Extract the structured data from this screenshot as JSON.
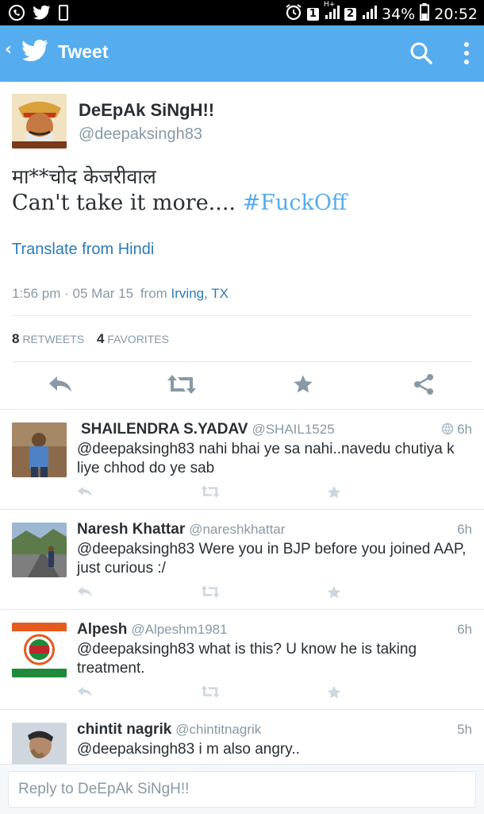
{
  "status_bar": {
    "battery_percent": "34%",
    "time": "20:52",
    "sim1": "1",
    "sim2": "2",
    "network_label": "H+"
  },
  "app_bar": {
    "title": "Tweet"
  },
  "tweet": {
    "author_name": "DeEpAk SiNgH!!",
    "author_handle": "@deepaksingh83",
    "text_line1": "मा**चोद केजरीवाल",
    "text_line2_prefix": "Can't take it more.... ",
    "hashtag": "#FuckOff",
    "translate_label": "Translate from Hindi",
    "timestamp": "1:56 pm · 05 Mar 15",
    "from_label": "from",
    "location": "Irving, TX",
    "retweets_count": "8",
    "retweets_label": "RETWEETS",
    "favorites_count": "4",
    "favorites_label": "FAVORITES"
  },
  "replies": [
    {
      "name": "SHAILENDRA S.YADAV",
      "handle": "@SHAIL1525",
      "time": "6h",
      "text": "@deepaksingh83 nahi bhai ye sa nahi..navedu chutiya k liye chhod do ye sab"
    },
    {
      "name": "Naresh Khattar",
      "handle": "@nareshkhattar",
      "time": "6h",
      "text": "@deepaksingh83 Were you in BJP before you joined AAP, just curious :/"
    },
    {
      "name": "Alpesh",
      "handle": "@Alpeshm1981",
      "time": "6h",
      "text": "@deepaksingh83 what is this? U know he is taking treatment."
    },
    {
      "name": "chintit nagrik",
      "handle": "@chintitnagrik",
      "time": "5h",
      "text": "@deepaksingh83 i m also angry.."
    }
  ],
  "reply_box": {
    "placeholder": "Reply to DeEpAk SiNgH!!"
  },
  "colors": {
    "brand": "#55acee",
    "link": "#2b7bb9",
    "muted": "#8899a6"
  }
}
